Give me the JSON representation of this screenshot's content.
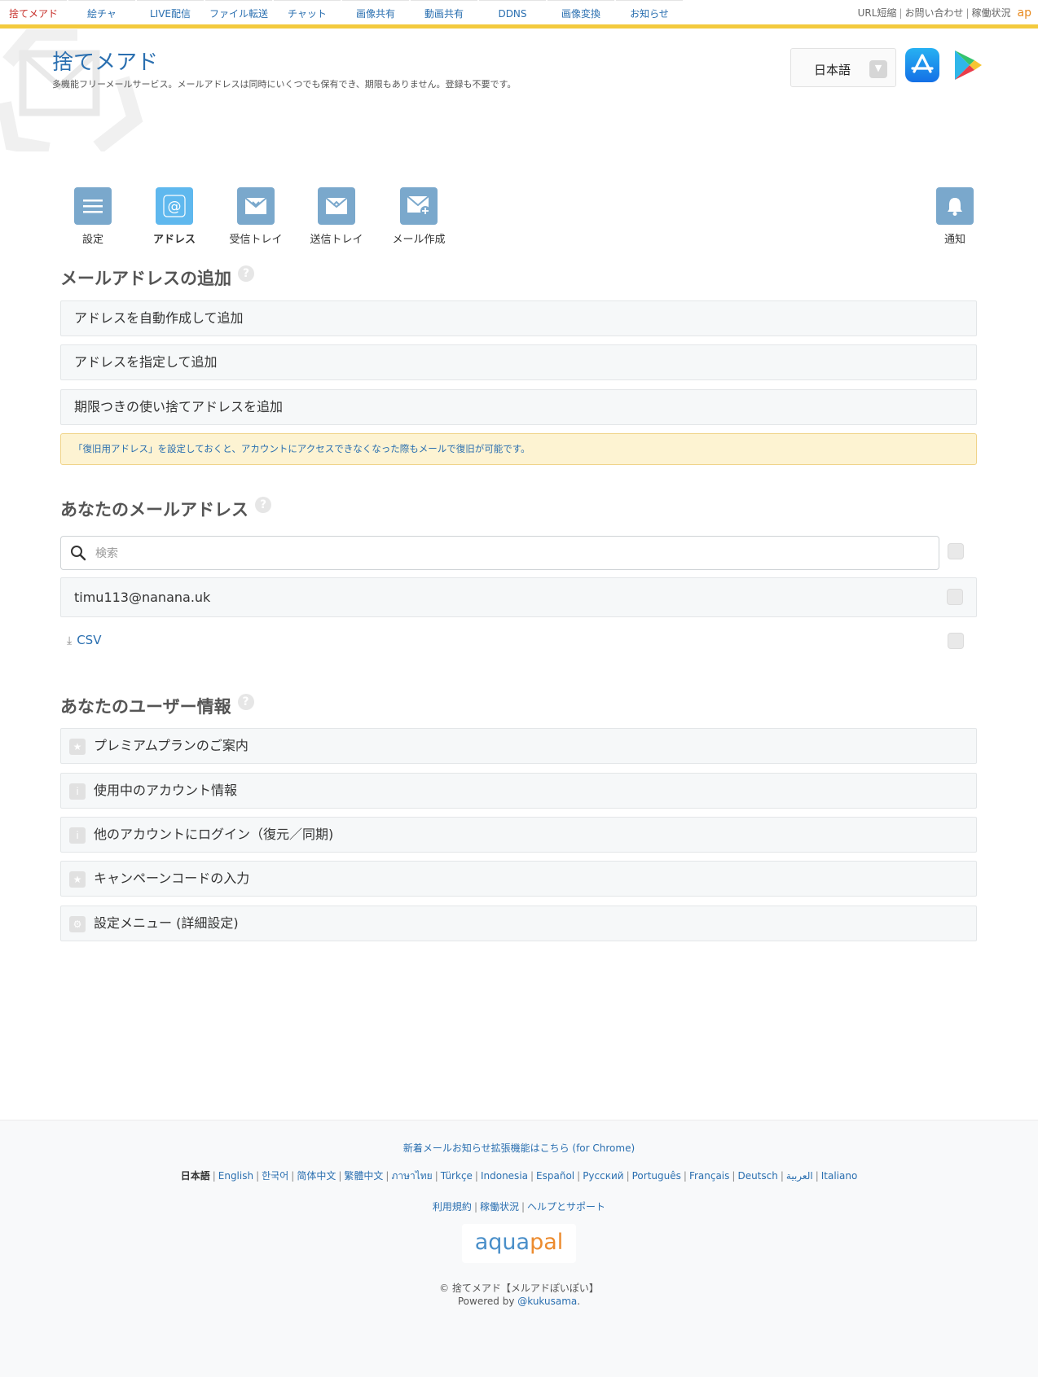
{
  "topnav": {
    "tabs": [
      "捨てメアド",
      "絵チャ",
      "LIVE配信",
      "ファイル転送",
      "チャット",
      "画像共有",
      "動画共有",
      "DDNS",
      "画像変換",
      "お知らせ"
    ],
    "right_links": [
      "URL短縮",
      "お問い合わせ",
      "稼働状況"
    ],
    "ap_logo": "ap"
  },
  "header": {
    "title": "捨てメアド",
    "subtitle": "多機能フリーメールサービス。メールアドレスは同時にいくつでも保有でき、期限もありません。登録も不要です。",
    "language": "日本語"
  },
  "menu": {
    "items": [
      "設定",
      "アドレス",
      "受信トレイ",
      "送信トレイ",
      "メール作成"
    ],
    "notify": "通知"
  },
  "add_section": {
    "title": "メールアドレスの追加",
    "options": [
      "アドレスを自動作成して追加",
      "アドレスを指定して追加",
      "期限つきの使い捨てアドレスを追加"
    ],
    "notice": "「復旧用アドレス」を設定しておくと、アカウントにアクセスできなくなった際もメールで復旧が可能です。"
  },
  "your_addresses": {
    "title": "あなたのメールアドレス",
    "search_placeholder": "検索",
    "addresses": [
      "timu113@nanana.uk"
    ],
    "csv_label": "CSV"
  },
  "user_info": {
    "title": "あなたのユーザー情報",
    "items": [
      "プレミアムプランのご案内",
      "使用中のアカウント情報",
      "他のアカウントにログイン（復元／同期)",
      "キャンペーンコードの入力",
      "設定メニュー (詳細設定)"
    ]
  },
  "footer": {
    "extension_link": "新着メールお知らせ拡張機能はこちら (for Chrome)",
    "current_language": "日本語",
    "languages": [
      "English",
      "한국어",
      "简体中文",
      "繁體中文",
      "ภาษาไทย",
      "Türkçe",
      "Indonesia",
      "Español",
      "Русский",
      "Português",
      "Français",
      "Deutsch",
      "العربية",
      "Italiano"
    ],
    "links": [
      "利用規約",
      "稼働状況",
      "ヘルプとサポート"
    ],
    "brand_a": "aqua",
    "brand_b": "pal",
    "copyright": "© 捨てメアド【メルアドぽいぽい】",
    "powered_prefix": "Powered by ",
    "powered_link": "@kukusama",
    "powered_suffix": "."
  },
  "colors": {
    "accent_blue": "#2a6fb0",
    "active_tab_red": "#c7302b",
    "top_stripe": "#f3ca3e",
    "menu_icon": "#7aa8cc",
    "menu_icon_active": "#5fb8ee",
    "notice_bg": "#fdf3d2"
  }
}
